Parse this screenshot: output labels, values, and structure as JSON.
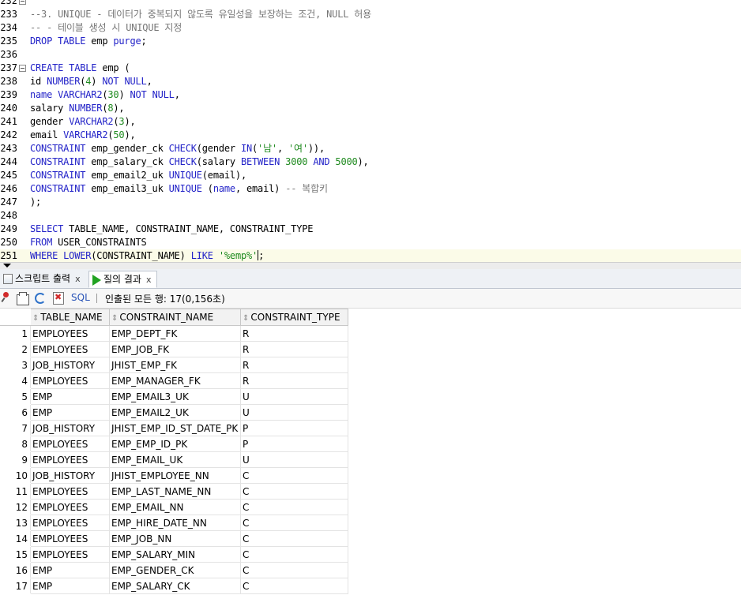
{
  "editor": {
    "lines": [
      {
        "num": "232",
        "fold": true,
        "tokens": []
      },
      {
        "num": "233",
        "tokens": [
          {
            "c": "cm",
            "t": "--3. UNIQUE - 데이터가 중복되지 않도록 유일성을 보장하는 조건, NULL 허용"
          }
        ]
      },
      {
        "num": "234",
        "tokens": [
          {
            "c": "cm",
            "t": "-- - 테이블 생성 시 UNIQUE 지정"
          }
        ]
      },
      {
        "num": "235",
        "tokens": [
          {
            "c": "kw",
            "t": "DROP TABLE"
          },
          {
            "c": "pl",
            "t": " emp "
          },
          {
            "c": "kw",
            "t": "purge"
          },
          {
            "c": "pl",
            "t": ";"
          }
        ]
      },
      {
        "num": "236",
        "tokens": []
      },
      {
        "num": "237",
        "fold": true,
        "tokens": [
          {
            "c": "kw",
            "t": "CREATE TABLE"
          },
          {
            "c": "pl",
            "t": " emp ("
          }
        ]
      },
      {
        "num": "238",
        "tokens": [
          {
            "c": "pl",
            "t": "id "
          },
          {
            "c": "kw",
            "t": "NUMBER"
          },
          {
            "c": "pl",
            "t": "("
          },
          {
            "c": "num",
            "t": "4"
          },
          {
            "c": "pl",
            "t": ") "
          },
          {
            "c": "kw",
            "t": "NOT NULL"
          },
          {
            "c": "pl",
            "t": ","
          }
        ]
      },
      {
        "num": "239",
        "tokens": [
          {
            "c": "kw",
            "t": "name"
          },
          {
            "c": "pl",
            "t": " "
          },
          {
            "c": "kw",
            "t": "VARCHAR2"
          },
          {
            "c": "pl",
            "t": "("
          },
          {
            "c": "num",
            "t": "30"
          },
          {
            "c": "pl",
            "t": ") "
          },
          {
            "c": "kw",
            "t": "NOT NULL"
          },
          {
            "c": "pl",
            "t": ","
          }
        ]
      },
      {
        "num": "240",
        "tokens": [
          {
            "c": "pl",
            "t": "salary "
          },
          {
            "c": "kw",
            "t": "NUMBER"
          },
          {
            "c": "pl",
            "t": "("
          },
          {
            "c": "num",
            "t": "8"
          },
          {
            "c": "pl",
            "t": "),"
          }
        ]
      },
      {
        "num": "241",
        "tokens": [
          {
            "c": "pl",
            "t": "gender "
          },
          {
            "c": "kw",
            "t": "VARCHAR2"
          },
          {
            "c": "pl",
            "t": "("
          },
          {
            "c": "num",
            "t": "3"
          },
          {
            "c": "pl",
            "t": "),"
          }
        ]
      },
      {
        "num": "242",
        "tokens": [
          {
            "c": "pl",
            "t": "email "
          },
          {
            "c": "kw",
            "t": "VARCHAR2"
          },
          {
            "c": "pl",
            "t": "("
          },
          {
            "c": "num",
            "t": "50"
          },
          {
            "c": "pl",
            "t": "),"
          }
        ]
      },
      {
        "num": "243",
        "tokens": [
          {
            "c": "kw",
            "t": "CONSTRAINT"
          },
          {
            "c": "pl",
            "t": " emp_gender_ck "
          },
          {
            "c": "kw",
            "t": "CHECK"
          },
          {
            "c": "pl",
            "t": "(gender "
          },
          {
            "c": "kw",
            "t": "IN"
          },
          {
            "c": "pl",
            "t": "("
          },
          {
            "c": "str",
            "t": "'남'"
          },
          {
            "c": "pl",
            "t": ", "
          },
          {
            "c": "str",
            "t": "'여'"
          },
          {
            "c": "pl",
            "t": ")),"
          }
        ]
      },
      {
        "num": "244",
        "tokens": [
          {
            "c": "kw",
            "t": "CONSTRAINT"
          },
          {
            "c": "pl",
            "t": " emp_salary_ck "
          },
          {
            "c": "kw",
            "t": "CHECK"
          },
          {
            "c": "pl",
            "t": "(salary "
          },
          {
            "c": "kw",
            "t": "BETWEEN"
          },
          {
            "c": "pl",
            "t": " "
          },
          {
            "c": "num",
            "t": "3000"
          },
          {
            "c": "pl",
            "t": " "
          },
          {
            "c": "kw",
            "t": "AND"
          },
          {
            "c": "pl",
            "t": " "
          },
          {
            "c": "num",
            "t": "5000"
          },
          {
            "c": "pl",
            "t": "),"
          }
        ]
      },
      {
        "num": "245",
        "tokens": [
          {
            "c": "kw",
            "t": "CONSTRAINT"
          },
          {
            "c": "pl",
            "t": " emp_email2_uk "
          },
          {
            "c": "kw",
            "t": "UNIQUE"
          },
          {
            "c": "pl",
            "t": "(email),"
          }
        ]
      },
      {
        "num": "246",
        "tokens": [
          {
            "c": "kw",
            "t": "CONSTRAINT"
          },
          {
            "c": "pl",
            "t": " emp_email3_uk "
          },
          {
            "c": "kw",
            "t": "UNIQUE"
          },
          {
            "c": "pl",
            "t": " ("
          },
          {
            "c": "kw",
            "t": "name"
          },
          {
            "c": "pl",
            "t": ", email) "
          },
          {
            "c": "cm",
            "t": "-- 복합키"
          }
        ]
      },
      {
        "num": "247",
        "tokens": [
          {
            "c": "pl",
            "t": ");"
          }
        ]
      },
      {
        "num": "248",
        "tokens": []
      },
      {
        "num": "249",
        "tokens": [
          {
            "c": "kw",
            "t": "SELECT"
          },
          {
            "c": "pl",
            "t": " TABLE_NAME, CONSTRAINT_NAME, CONSTRAINT_TYPE"
          }
        ]
      },
      {
        "num": "250",
        "tokens": [
          {
            "c": "kw",
            "t": "FROM"
          },
          {
            "c": "pl",
            "t": " USER_CONSTRAINTS"
          }
        ]
      },
      {
        "num": "251",
        "current": true,
        "tokens": [
          {
            "c": "kw",
            "t": "WHERE"
          },
          {
            "c": "pl",
            "t": " "
          },
          {
            "c": "kw",
            "t": "LOWER"
          },
          {
            "c": "pl",
            "t": "(CONSTRAINT_NAME) "
          },
          {
            "c": "kw",
            "t": "LIKE"
          },
          {
            "c": "pl",
            "t": " "
          },
          {
            "c": "str",
            "t": "'%emp%'"
          },
          {
            "c": "caret",
            "t": ""
          },
          {
            "c": "pl",
            "t": ";"
          }
        ]
      }
    ]
  },
  "tabs": [
    {
      "label": "스크립트 출력",
      "close": "x",
      "icon": "script-output-icon"
    },
    {
      "label": "질의 결과",
      "close": "x",
      "icon": "run-result-icon"
    }
  ],
  "toolbar": {
    "sql_label": "SQL",
    "fetch_info": "인출된 모든 행: 17(0,156초)"
  },
  "grid": {
    "columns": [
      "TABLE_NAME",
      "CONSTRAINT_NAME",
      "CONSTRAINT_TYPE"
    ],
    "rows": [
      [
        "1",
        "EMPLOYEES",
        "EMP_DEPT_FK",
        "R"
      ],
      [
        "2",
        "EMPLOYEES",
        "EMP_JOB_FK",
        "R"
      ],
      [
        "3",
        "JOB_HISTORY",
        "JHIST_EMP_FK",
        "R"
      ],
      [
        "4",
        "EMPLOYEES",
        "EMP_MANAGER_FK",
        "R"
      ],
      [
        "5",
        "EMP",
        "EMP_EMAIL3_UK",
        "U"
      ],
      [
        "6",
        "EMP",
        "EMP_EMAIL2_UK",
        "U"
      ],
      [
        "7",
        "JOB_HISTORY",
        "JHIST_EMP_ID_ST_DATE_PK",
        "P"
      ],
      [
        "8",
        "EMPLOYEES",
        "EMP_EMP_ID_PK",
        "P"
      ],
      [
        "9",
        "EMPLOYEES",
        "EMP_EMAIL_UK",
        "U"
      ],
      [
        "10",
        "JOB_HISTORY",
        "JHIST_EMPLOYEE_NN",
        "C"
      ],
      [
        "11",
        "EMPLOYEES",
        "EMP_LAST_NAME_NN",
        "C"
      ],
      [
        "12",
        "EMPLOYEES",
        "EMP_EMAIL_NN",
        "C"
      ],
      [
        "13",
        "EMPLOYEES",
        "EMP_HIRE_DATE_NN",
        "C"
      ],
      [
        "14",
        "EMPLOYEES",
        "EMP_JOB_NN",
        "C"
      ],
      [
        "15",
        "EMPLOYEES",
        "EMP_SALARY_MIN",
        "C"
      ],
      [
        "16",
        "EMP",
        "EMP_GENDER_CK",
        "C"
      ],
      [
        "17",
        "EMP",
        "EMP_SALARY_CK",
        "C"
      ]
    ]
  }
}
